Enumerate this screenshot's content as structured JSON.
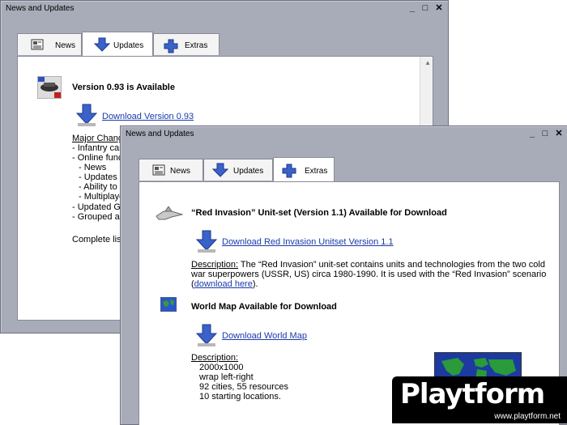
{
  "back_window": {
    "title": "News and Updates",
    "tabs": [
      {
        "label": "News",
        "icon": "newspaper-icon"
      },
      {
        "label": "Updates",
        "icon": "download-arrow-icon"
      },
      {
        "label": "Extras",
        "icon": "plus-cross-icon"
      }
    ],
    "active_tab": "Updates",
    "heading": "Version 0.93 is Available",
    "download_link": "Download Version 0.93",
    "lines": [
      "Major Change",
      "- Infantry can",
      "- Online funct",
      "  - News",
      "  - Updates",
      "  - Ability to c",
      "  - Multiplaye",
      "- Updated Ga",
      "- Grouped air",
      "",
      "Complete list"
    ]
  },
  "front_window": {
    "title": "News and Updates",
    "tabs": [
      {
        "label": "News",
        "icon": "newspaper-icon"
      },
      {
        "label": "Updates",
        "icon": "download-arrow-icon"
      },
      {
        "label": "Extras",
        "icon": "plus-cross-icon"
      }
    ],
    "active_tab": "Extras",
    "item1": {
      "heading": "“Red Invasion” Unit-set (Version 1.1) Available for Download",
      "download_link": "Download Red Invasion Unitset Version 1.1",
      "desc_label": "Description:",
      "desc_line1": " The “Red Invasion” unit-set contains units and technologies from the two cold",
      "desc_line2": "war superpowers (USSR, US) circa 1980-1990.  It is used with the “Red Invasion” scenario",
      "desc_paren_open": "(",
      "desc_link": "download here",
      "desc_paren_close": ")."
    },
    "item2": {
      "heading": "World Map Available for Download",
      "download_link": "Download World Map",
      "desc_label": "Description:",
      "lines": [
        "2000x1000",
        "wrap left-right",
        "92 cities, 55 resources",
        "10 starting locations."
      ]
    }
  },
  "watermark": {
    "brand": "Playtform",
    "url": "www.playtform.net"
  },
  "colors": {
    "window_frame": "#a8abb8",
    "link": "#1a3aa8",
    "arrow": "#3a62c8"
  }
}
